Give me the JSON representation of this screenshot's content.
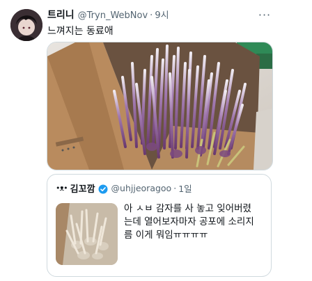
{
  "author": {
    "display_name": "트리니",
    "handle": "@Tryn_WebNov",
    "separator": "·",
    "time": "9시"
  },
  "tweet": {
    "text": "느껴지는 동료애"
  },
  "quoted": {
    "avatar_glyph": "•ᴥ•",
    "display_name": "김꼬깜",
    "handle": "@uhjjeoragoo",
    "separator": "·",
    "time": "1일",
    "text_lines": [
      "아 ㅅㅂ 감자를 사 놓고 잊어버렸",
      "는데 열어보자마자 공포에 소리지",
      "름 이게 뭐임ㅠㅠㅠㅠ"
    ]
  },
  "icons": {
    "more": "more-icon",
    "verified": "verified-badge-icon"
  },
  "colors": {
    "text": "#0f1419",
    "secondary": "#536471",
    "border": "#cfd9de",
    "verified": "#1d9bf0",
    "sprout_purple": "#8a5a8c"
  }
}
